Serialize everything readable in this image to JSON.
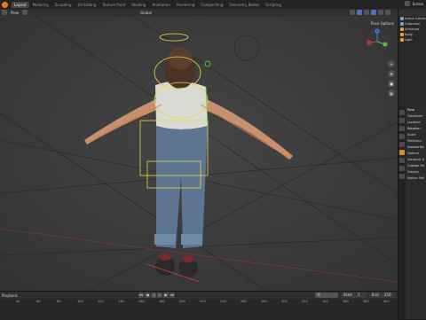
{
  "topbar": {
    "tabs": [
      {
        "label": "Layout",
        "active": true
      },
      {
        "label": "Modeling",
        "active": false
      },
      {
        "label": "Sculpting",
        "active": false
      },
      {
        "label": "UV Editing",
        "active": false
      },
      {
        "label": "Texture Paint",
        "active": false
      },
      {
        "label": "Shading",
        "active": false
      },
      {
        "label": "Animation",
        "active": false
      },
      {
        "label": "Rendering",
        "active": false
      },
      {
        "label": "Compositing",
        "active": false
      },
      {
        "label": "Geometry Nodes",
        "active": false
      },
      {
        "label": "Scripting",
        "active": false
      }
    ],
    "scene": "Scene"
  },
  "viewport": {
    "mode": "Pose",
    "orientation": "Global",
    "pose_options": "Pose Options"
  },
  "navigation": {
    "axes": [
      "X",
      "Y",
      "Z"
    ]
  },
  "timeline": {
    "menu": "Playback",
    "current_frame": "0",
    "start_label": "Start",
    "start": "1",
    "end_label": "End",
    "end": "250",
    "ruler": [
      "40",
      "60",
      "80",
      "100",
      "120",
      "140",
      "160",
      "180",
      "200",
      "220",
      "240",
      "260",
      "280",
      "300",
      "320",
      "340",
      "360",
      "380",
      "400"
    ]
  },
  "outliner": {
    "rows": [
      "Scene Collection",
      "Collection",
      "Armature",
      "Body",
      "Light"
    ]
  },
  "properties": {
    "rows": [
      "Pose",
      "Transform",
      "Location",
      "Rotation",
      "Scale",
      "Relations",
      "Inverse Kinematics",
      "Deform",
      "Viewport Display",
      "Custom Properties",
      "Display",
      "Motion Paths"
    ]
  },
  "colors": {
    "accent": "#e87d0d",
    "selection": "#4772b3",
    "rig_yellow": "#e8d84a",
    "rig_green": "#5fd94a"
  }
}
